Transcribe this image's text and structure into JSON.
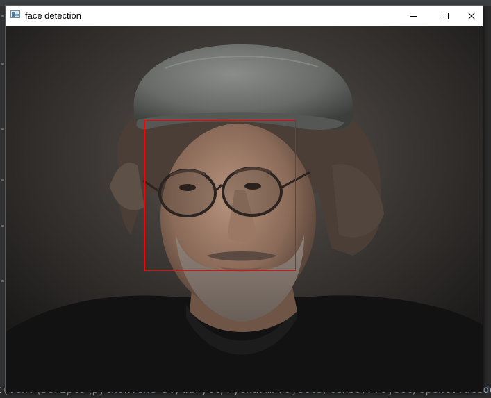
{
  "window": {
    "title": "face detection",
    "app_icon": "opencv-window-icon",
    "controls": {
      "minimize_icon": "minimize-icon",
      "maximize_icon": "maximize-icon",
      "close_icon": "close-icon"
    }
  },
  "image": {
    "subject": "",
    "detection_box_color": "#ff0000"
  },
  "console": {
    "visible_line": "t(venv\\Scripts\\python.exe D:/daryll/PycharmProjects/tensorProject/opencvfacedet.py"
  },
  "colors": {
    "ide_background": "#2b2b2b",
    "window_background": "#ffffff",
    "console_text": "#a9b7c6"
  }
}
